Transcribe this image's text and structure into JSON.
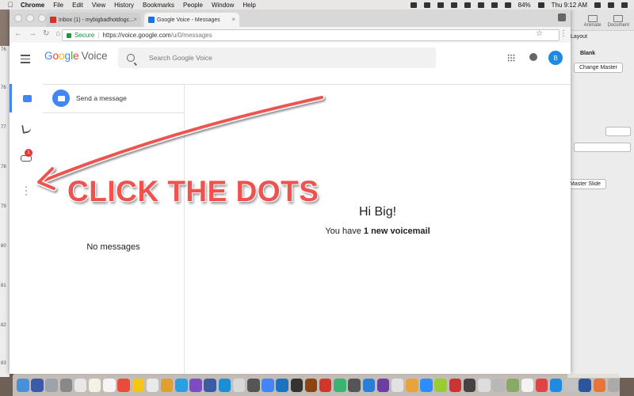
{
  "menubar": {
    "app": "Chrome",
    "items": [
      "File",
      "Edit",
      "View",
      "History",
      "Bookmarks",
      "People",
      "Window",
      "Help"
    ],
    "battery": "84%",
    "clock": "Thu 9:12 AM"
  },
  "keynote": {
    "tabs": [
      "Animate",
      "Document"
    ],
    "layout_label": "Layout",
    "blank_label": "Blank",
    "change_master": "Change Master",
    "master_slide": "Master Slide"
  },
  "ruler": [
    "76",
    "76",
    "77",
    "78",
    "79",
    "80",
    "81",
    "82",
    "83"
  ],
  "chrome": {
    "tabs": [
      {
        "title": "Inbox (1) - mybigbadhotdogc...",
        "active": false,
        "favicon_color": "#d93025"
      },
      {
        "title": "Google Voice - Messages",
        "active": true,
        "favicon_color": "#1a73e8"
      }
    ],
    "secure_label": "Secure",
    "url_host": "https://voice.google.com",
    "url_path": "/u/0/messages"
  },
  "gv": {
    "logo_google": [
      "G",
      "o",
      "o",
      "g",
      "l",
      "e"
    ],
    "logo_product": "Voice",
    "search_placeholder": "Search Google Voice",
    "avatar_letter": "B",
    "voicemail_badge": "1",
    "send_message": "Send a message",
    "no_messages": "No messages",
    "greeting": "Hi Big!",
    "voicemail_prefix": "You have",
    "voicemail_count": "1 new voicemail"
  },
  "annotation": {
    "callout": "CLICK THE DOTS",
    "color": "#ef5350"
  },
  "dock_colors": [
    "#4a90d9",
    "#3b5aa8",
    "#9ea3aa",
    "#888",
    "#e8e8e8",
    "#f4f1e6",
    "#f5f5f5",
    "#e94b3c",
    "#f5c518",
    "#e9e9e9",
    "#e0a030",
    "#2aa0e0",
    "#7d4cc2",
    "#3d5aa5",
    "#1c8ed4",
    "#d8d8d8",
    "#555",
    "#4285f4",
    "#1e73be",
    "#333",
    "#8b4513",
    "#d0362a",
    "#3cb371",
    "#555",
    "#2a7fd4",
    "#6b3fa0",
    "#e2e2e2",
    "#e8a33d",
    "#2d8cff",
    "#9c3",
    "#cc3333",
    "#444",
    "#ddd",
    "#b8b8b8",
    "#8a6",
    "#f3f3f3",
    "#d44",
    "#1f8be0",
    "#c3c3c3",
    "#2b579a",
    "#e9743a",
    "#aaa"
  ]
}
